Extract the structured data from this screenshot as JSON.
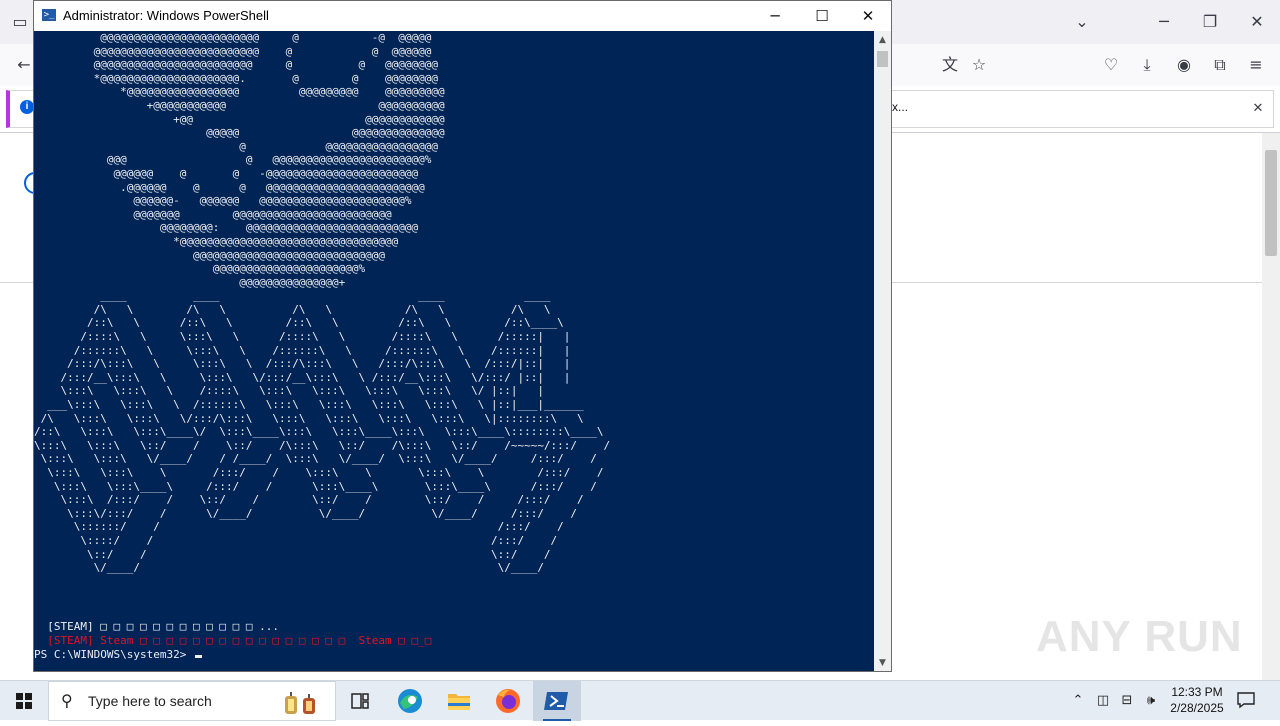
{
  "browser": {
    "partial_tab_text": "x...",
    "info_icon": "info-icon"
  },
  "powershell": {
    "title": "Administrator: Windows PowerShell",
    "controls": {
      "minimize": "─",
      "maximize": "☐",
      "close": "✕"
    },
    "ascii_art": "          @@@@@@@@@@@@@@@@@@@@@@@@     @           -@  @@@@@\n         @@@@@@@@@@@@@@@@@@@@@@@@@    @            @  @@@@@@\n         @@@@@@@@@@@@@@@@@@@@@@@@     @          @   @@@@@@@@\n         *@@@@@@@@@@@@@@@@@@@@@.       @        @    @@@@@@@@\n             *@@@@@@@@@@@@@@@@@         @@@@@@@@@    @@@@@@@@@\n                 +@@@@@@@@@@@                       @@@@@@@@@@\n                     +@@                          @@@@@@@@@@@@\n                          @@@@@                 @@@@@@@@@@@@@@\n                               @            @@@@@@@@@@@@@@@@@\n           @@@                  @   @@@@@@@@@@@@@@@@@@@@@@@%\n            @@@@@@    @       @   -@@@@@@@@@@@@@@@@@@@@@@@\n             .@@@@@@    @      @   @@@@@@@@@@@@@@@@@@@@@@@@\n               @@@@@@-   @@@@@@   @@@@@@@@@@@@@@@@@@@@@@%\n               @@@@@@@        @@@@@@@@@@@@@@@@@@@@@@@@\n                   @@@@@@@@:    @@@@@@@@@@@@@@@@@@@@@@@@@@\n                     *@@@@@@@@@@@@@@@@@@@@@@@@@@@@@@@@@\n                        @@@@@@@@@@@@@@@@@@@@@@@@@@@@@\n                           @@@@@@@@@@@@@@@@@@@@@@%\n                               @@@@@@@@@@@@@@@+\n          ____          ____                              ____            ____\n         /\\   \\        /\\   \\          /\\   \\           /\\   \\          /\\   \\\n        /::\\   \\      /::\\   \\        /::\\   \\         /::\\   \\        /::\\____\\\n       /::::\\   \\     \\:::\\   \\      /::::\\   \\       /::::\\   \\      /:::::|   |\n      /::::::\\   \\     \\:::\\   \\    /::::::\\   \\     /::::::\\   \\    /::::::|   |\n     /:::/\\:::\\   \\     \\:::\\   \\  /:::/\\:::\\   \\   /:::/\\:::\\   \\  /:::/|::|   |\n    /:::/__\\:::\\   \\     \\:::\\   \\/:::/__\\:::\\   \\ /:::/__\\:::\\   \\/:::/ |::|   |\n    \\:::\\   \\:::\\   \\    /::::\\   \\:::\\   \\:::\\   \\:::\\   \\:::\\   \\/ |::|   |\n  ___\\:::\\   \\:::\\   \\  /::::::\\   \\:::\\   \\:::\\   \\:::\\   \\:::\\   \\ |::|___|______\n /\\   \\:::\\   \\:::\\   \\/:::/\\:::\\   \\:::\\   \\:::\\   \\:::\\   \\:::\\   \\|::::::::\\   \\\n/::\\   \\:::\\   \\:::\\____\\/  \\:::\\____\\:::\\   \\:::\\____\\:::\\   \\:::\\____\\::::::::\\____\\\n\\:::\\   \\:::\\   \\::/    /    \\::/    /\\:::\\   \\::/    /\\:::\\   \\::/    /~~~~~/:::/    /\n \\:::\\   \\:::\\   \\/____/    / /____/  \\:::\\   \\/____/  \\:::\\   \\/____/     /:::/    /\n  \\:::\\   \\:::\\    \\       /:::/    /    \\:::\\    \\       \\:::\\    \\        /:::/    /\n   \\:::\\   \\:::\\____\\     /:::/    /      \\:::\\____\\       \\:::\\____\\      /:::/    /\n    \\:::\\  /:::/    /    \\::/    /        \\::/    /        \\::/    /     /:::/    /\n     \\:::\\/:::/    /      \\/____/          \\/____/          \\/____/     /:::/    /\n      \\::::::/    /                                                   /:::/    /\n       \\::::/    /                                                   /:::/    /\n        \\::/    /                                                    \\::/    /\n         \\/____/                                                      \\/____/",
    "line1": "  [STEAM] □ □ □ □ □ □ □ □ □ □ □ □ ...",
    "line2": "  [STEAM] Steam □ □ □ □ □ □ □ □ □ □ □ □ □ □ □ □  Steam □ □_□",
    "prompt": "PS C:\\WINDOWS\\system32> "
  },
  "watermark": "ANY RUN",
  "taskbar": {
    "search_placeholder": "Type here to search",
    "time": "12:33 PM",
    "date": "2/28/2025"
  },
  "colors": {
    "console_bg": "#012456",
    "console_fg": "#eeedf0",
    "console_red": "#e81123",
    "accent": "#1f5ba8"
  }
}
